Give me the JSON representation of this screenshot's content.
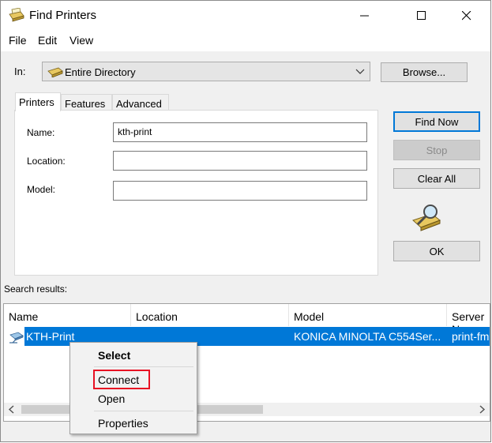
{
  "window": {
    "title": "Find Printers"
  },
  "menu": [
    "File",
    "Edit",
    "View"
  ],
  "in": {
    "label": "In:",
    "value": "Entire Directory",
    "browse": "Browse..."
  },
  "tabs": [
    "Printers",
    "Features",
    "Advanced"
  ],
  "fields": {
    "name": {
      "label": "Name:",
      "value": "kth-print"
    },
    "location": {
      "label": "Location:",
      "value": ""
    },
    "model": {
      "label": "Model:",
      "value": ""
    }
  },
  "buttons": {
    "find_now": "Find Now",
    "stop": "Stop",
    "clear_all": "Clear All",
    "ok": "OK"
  },
  "results": {
    "label": "Search results:",
    "columns": [
      "Name",
      "Location",
      "Model",
      "Server N"
    ],
    "rows": [
      {
        "name": "KTH-Print",
        "location": "",
        "model": "KONICA MINOLTA C554Ser...",
        "server": "print-fm"
      }
    ]
  },
  "context_menu": [
    "Select",
    "Connect",
    "Open",
    "Properties"
  ],
  "colors": {
    "selection": "#0078d7",
    "highlight_box": "#e81123"
  }
}
